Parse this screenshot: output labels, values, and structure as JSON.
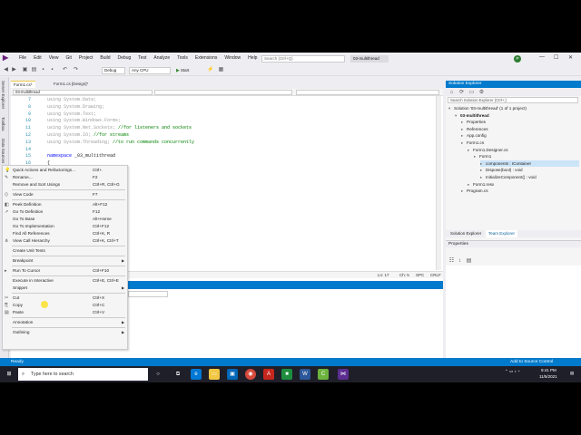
{
  "menu": {
    "items": [
      "File",
      "Edit",
      "View",
      "Git",
      "Project",
      "Build",
      "Debug",
      "Test",
      "Analyze",
      "Tools",
      "Extensions",
      "Window",
      "Help"
    ],
    "search_placeholder": "Search (Ctrl+Q)",
    "solution_name": "03-multithread",
    "avatar_initial": "P"
  },
  "toolbar": {
    "config": "Debug",
    "platform": "Any CPU",
    "start_label": "Start"
  },
  "left_strip": [
    "Server Explorer",
    "Toolbox",
    "Data Sources"
  ],
  "tabs": [
    {
      "label": "Form1.cs*",
      "active": true
    },
    {
      "label": "Form1.cs [Design]*",
      "active": false
    }
  ],
  "editor": {
    "nav_project": "03-multithread",
    "lines": [
      {
        "n": "7",
        "text": "using System.Data;"
      },
      {
        "n": "8",
        "text": "using System.Drawing;"
      },
      {
        "n": "9",
        "text": "using System.Text;"
      },
      {
        "n": "10",
        "text": "using System.Windows.Forms;"
      },
      {
        "n": "11",
        "text": "using System.Net.Sockets; //for listeners and sockets"
      },
      {
        "n": "12",
        "text": "using System.IO; //for streams"
      },
      {
        "n": "13",
        "text": "using System.Threading; //to run commands concurrently"
      },
      {
        "n": "14",
        "text": ""
      },
      {
        "n": "15",
        "text": "namespace _03_multithread"
      },
      {
        "n": "16",
        "text": "{"
      }
    ],
    "status": {
      "ln": "Ln: 17",
      "ch": "Ch: 5",
      "spc": "SPC",
      "crlf": "CRLF"
    }
  },
  "context_menu": [
    {
      "label": "Quick Actions and Refactorings...",
      "shortcut": "Ctrl+.",
      "icon": "lightbulb-icon"
    },
    {
      "label": "Rename...",
      "shortcut": "F2",
      "icon": "rename-icon"
    },
    {
      "label": "Remove and Sort Usings",
      "shortcut": "Ctrl+R, Ctrl+G",
      "icon": ""
    },
    {
      "sep": true
    },
    {
      "label": "View Code",
      "shortcut": "F7",
      "icon": "code-icon"
    },
    {
      "sep": true
    },
    {
      "label": "Peek Definition",
      "shortcut": "Alt+F12",
      "icon": "peek-icon"
    },
    {
      "label": "Go To Definition",
      "shortcut": "F12",
      "icon": "goto-icon"
    },
    {
      "label": "Go To Base",
      "shortcut": "Alt+Home",
      "icon": ""
    },
    {
      "label": "Go To Implementation",
      "shortcut": "Ctrl+F12",
      "icon": ""
    },
    {
      "label": "Find All References",
      "shortcut": "Ctrl+K, R",
      "icon": ""
    },
    {
      "label": "View Call Hierarchy",
      "shortcut": "Ctrl+K, Ctrl+T",
      "icon": "hierarchy-icon"
    },
    {
      "sep": true
    },
    {
      "label": "Create Unit Tests",
      "shortcut": "",
      "icon": ""
    },
    {
      "sep": true
    },
    {
      "label": "Breakpoint",
      "shortcut": "",
      "icon": "",
      "submenu": true
    },
    {
      "sep": true
    },
    {
      "label": "Run To Cursor",
      "shortcut": "Ctrl+F10",
      "icon": "run-cursor-icon"
    },
    {
      "sep": true
    },
    {
      "label": "Execute in Interactive",
      "shortcut": "Ctrl+E, Ctrl+E",
      "icon": ""
    },
    {
      "label": "Snippet",
      "shortcut": "",
      "icon": "",
      "submenu": true
    },
    {
      "sep": true
    },
    {
      "label": "Cut",
      "shortcut": "Ctrl+X",
      "icon": "cut-icon"
    },
    {
      "label": "Copy",
      "shortcut": "Ctrl+C",
      "icon": "copy-icon"
    },
    {
      "label": "Paste",
      "shortcut": "Ctrl+V",
      "icon": "paste-icon"
    },
    {
      "sep": true
    },
    {
      "label": "Annotation",
      "shortcut": "",
      "icon": "",
      "submenu": true
    },
    {
      "sep": true
    },
    {
      "label": "Outlining",
      "shortcut": "",
      "icon": "",
      "submenu": true
    }
  ],
  "solution_explorer": {
    "title": "Solution Explorer",
    "search_placeholder": "Search Solution Explorer (Ctrl+;)",
    "tree": [
      {
        "label": "Solution '03-multithread' (1 of 1 project)",
        "indent": 0,
        "bold": false
      },
      {
        "label": "03-multithread",
        "indent": 1,
        "bold": true
      },
      {
        "label": "Properties",
        "indent": 2,
        "bold": false
      },
      {
        "label": "References",
        "indent": 2,
        "bold": false
      },
      {
        "label": "App.config",
        "indent": 2,
        "bold": false
      },
      {
        "label": "Form1.cs",
        "indent": 2,
        "bold": false
      },
      {
        "label": "Form1.Designer.cs",
        "indent": 3,
        "bold": false
      },
      {
        "label": "Form1",
        "indent": 4,
        "bold": false
      },
      {
        "label": "components : IContainer",
        "indent": 5,
        "bold": false,
        "selected": true
      },
      {
        "label": "Dispose(bool) : void",
        "indent": 5,
        "bold": false
      },
      {
        "label": "InitializeComponent() : void",
        "indent": 5,
        "bold": false
      },
      {
        "label": "Form1.resx",
        "indent": 3,
        "bold": false
      },
      {
        "label": "Program.cs",
        "indent": 2,
        "bold": false
      }
    ],
    "tabs": [
      "Solution Explorer",
      "Team Explorer"
    ]
  },
  "properties": {
    "title": "Properties"
  },
  "statusbar": {
    "ready": "Ready",
    "source_control": "Add to Source Control"
  },
  "taskbar": {
    "search": "Type here to search",
    "time": "9:41 PM",
    "date": "11/5/2021"
  },
  "colors": {
    "accent": "#007acc",
    "menu_bg": "#eeeef2",
    "selection": "#cce4f7"
  }
}
